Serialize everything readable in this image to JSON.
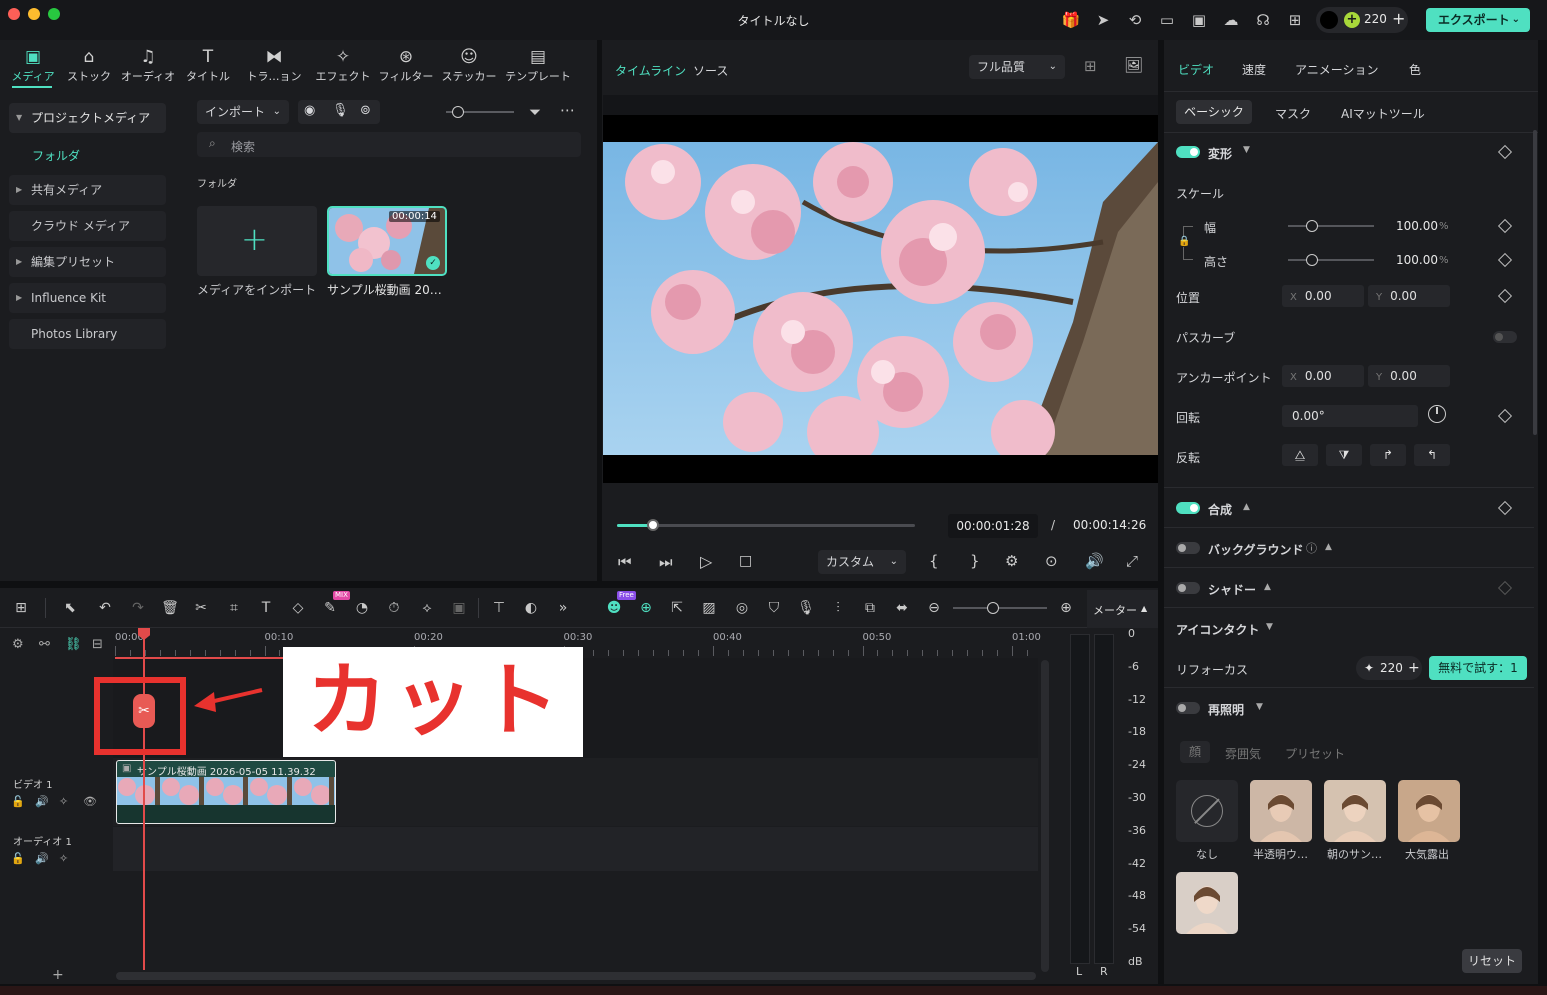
{
  "window": {
    "title": "タイトルなし",
    "credits": "220",
    "export_label": "エクスポート"
  },
  "media_tabs": [
    "メディア",
    "ストック",
    "オーディオ",
    "タイトル",
    "トラ…ョン",
    "エフェクト",
    "フィルター",
    "ステッカー",
    "テンプレート"
  ],
  "media_sidebar": {
    "items": [
      "プロジェクトメディア",
      "フォルダ",
      "共有メディア",
      "クラウド メディア",
      "編集プリセット",
      "Influence Kit",
      "Photos Library"
    ]
  },
  "media_main": {
    "import_label": "インポート",
    "search_placeholder": "検索",
    "section_label": "フォルダ",
    "import_tile_label": "メディアをインポート",
    "clip_label": "サンプル桜動画 20…",
    "clip_duration": "00:00:14"
  },
  "preview": {
    "tab_timeline": "タイムライン",
    "tab_source": "ソース",
    "quality": "フル品質",
    "current_time": "00:00:01:28",
    "separator": "/",
    "total_time": "00:00:14:26",
    "custom_label": "カスタム",
    "progress": 0.12
  },
  "properties": {
    "tabs": [
      "ビデオ",
      "速度",
      "アニメーション",
      "色"
    ],
    "subtabs": [
      "ベーシック",
      "マスク",
      "AIマットツール"
    ],
    "transform": "変形",
    "scale": "スケール",
    "width_label": "幅",
    "width_value": "100.00",
    "height_label": "高さ",
    "height_value": "100.00",
    "percent": "%",
    "position": "位置",
    "pos_x": "0.00",
    "pos_y": "0.00",
    "path_curve": "パスカーブ",
    "anchor": "アンカーポイント",
    "anchor_x": "0.00",
    "anchor_y": "0.00",
    "rotation": "回転",
    "rotation_value": "0.00°",
    "flip": "反転",
    "composite": "合成",
    "background": "バックグラウンド",
    "shadow": "シャドー",
    "eye_contact": "アイコンタクト",
    "refocus": "リフォーカス",
    "refocus_credits": "220",
    "try_free": "無料で試す：1",
    "relight": "再照明",
    "relight_tabs": [
      "顔",
      "雰囲気",
      "プリセット"
    ],
    "presets": [
      "なし",
      "半透明ウ…",
      "朝のサン…",
      "大気露出"
    ],
    "reset": "リセット",
    "axis_x": "X",
    "axis_y": "Y"
  },
  "timeline": {
    "ruler": [
      "00:00",
      "00:10",
      "00:20",
      "00:30",
      "00:40",
      "00:50",
      "01:00"
    ],
    "meter_label": "メーター",
    "meter_scale": [
      "0",
      "-6",
      "-12",
      "-18",
      "-24",
      "-30",
      "-36",
      "-42",
      "-48",
      "-54",
      "dB"
    ],
    "meter_lr": [
      "L",
      "R"
    ],
    "video_track": "ビデオ 1",
    "audio_track": "オーディオ 1",
    "clip_title": "サンプル桜動画 2026-05-05 11.39.32",
    "annotation": "カット",
    "mix_badge": "MIX",
    "free_badge": "Free"
  }
}
